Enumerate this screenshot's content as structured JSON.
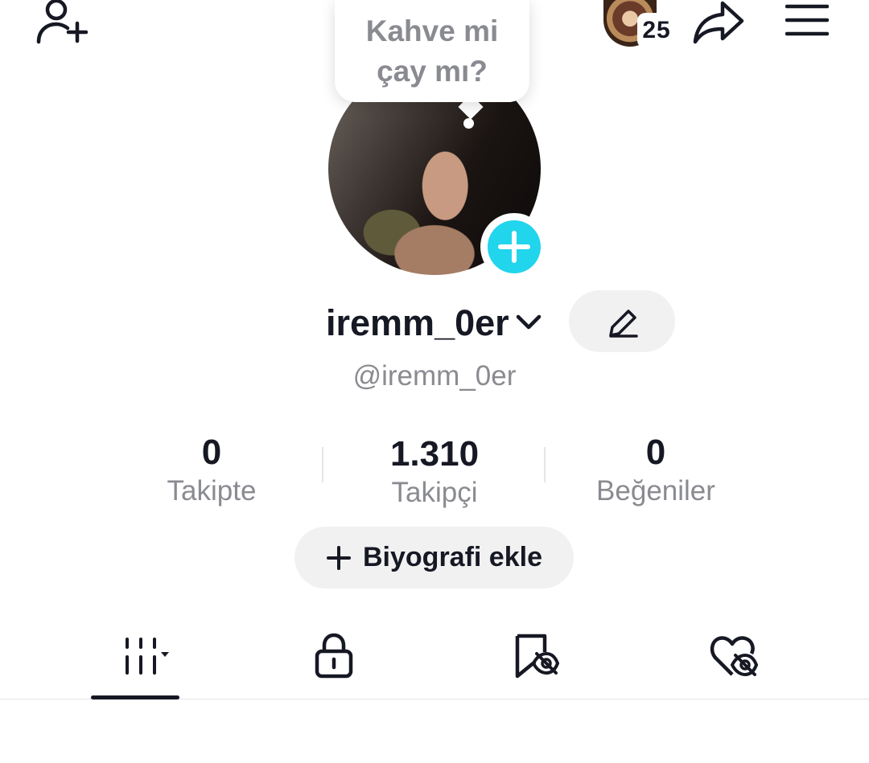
{
  "header": {
    "add_user_icon": "person-plus-icon",
    "story": {
      "count": "25"
    },
    "share_icon": "share-arrow-icon",
    "menu_icon": "hamburger-menu-icon"
  },
  "tooltip": {
    "line1": "Kahve mi",
    "line2": "çay mı?"
  },
  "profile": {
    "username": "iremm_0er",
    "handle": "@iremm_0er",
    "accent_color": "#20d5ec"
  },
  "stats": [
    {
      "value": "0",
      "label": "Takipte"
    },
    {
      "value": "1.310",
      "label": "Takipçi"
    },
    {
      "value": "0",
      "label": "Beğeniler"
    }
  ],
  "bio_button": {
    "label": "Biyografi ekle"
  },
  "tabs": [
    {
      "icon": "grid-videos-icon",
      "active": true
    },
    {
      "icon": "lock-icon",
      "active": false
    },
    {
      "icon": "bookmark-hidden-icon",
      "active": false
    },
    {
      "icon": "heart-hidden-icon",
      "active": false
    }
  ]
}
